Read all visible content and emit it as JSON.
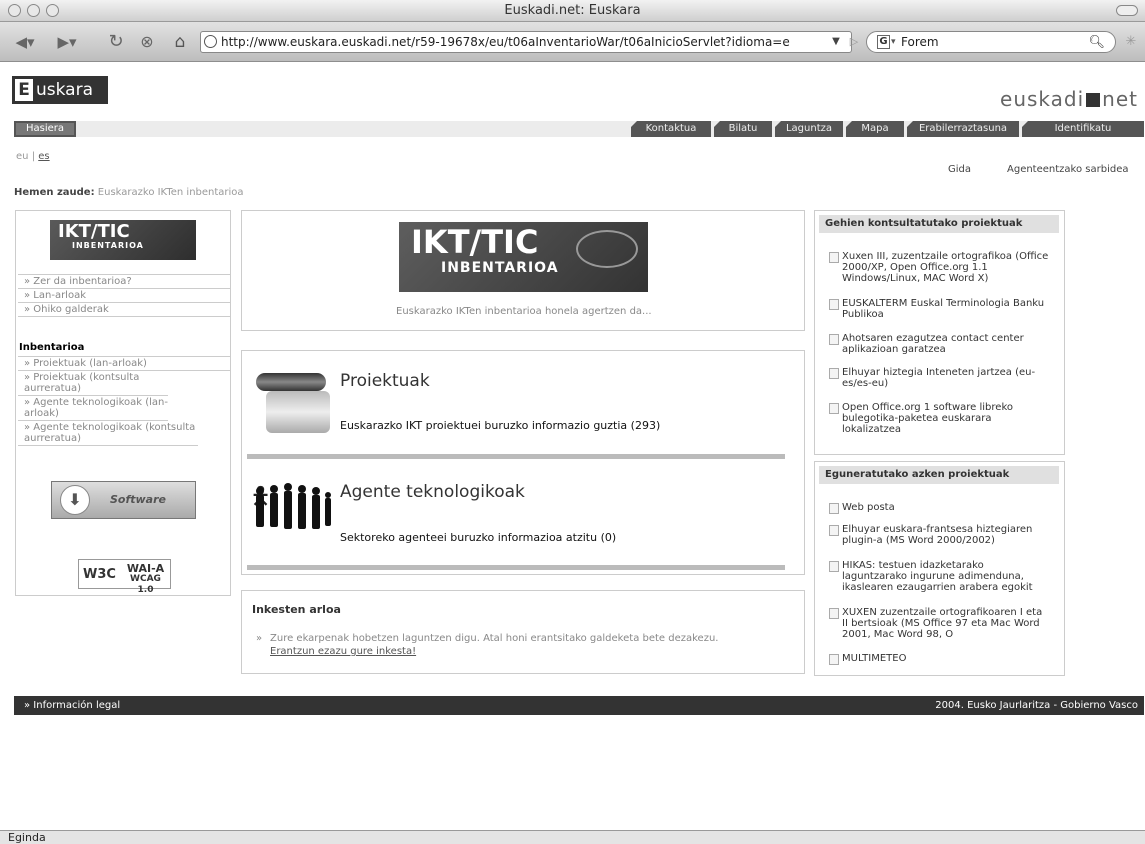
{
  "window": {
    "title": "Euskadi.net: Euskara"
  },
  "browser": {
    "url": "http://www.euskara.euskadi.net/r59-19678x/eu/t06aInventarioWar/t06aInicioServlet?idioma=e",
    "search_engine_letter": "G",
    "search_value": "Forem"
  },
  "header": {
    "logo_text": "uskara",
    "logo_letter": "E",
    "euskadi_logo_left": "euskadi",
    "euskadi_logo_right": "net"
  },
  "nav": {
    "home": "Hasiera",
    "tabs": [
      "Kontaktua",
      "Bilatu",
      "Laguntza",
      "Mapa",
      "Erabilerraztasuna",
      "Identifikatu"
    ]
  },
  "lang": {
    "current": "eu",
    "sep": "|",
    "other": "es"
  },
  "toplinks": {
    "gida": "Gida",
    "agents": "Agenteentzako sarbidea"
  },
  "breadcrumb": {
    "label": "Hemen zaude:",
    "path": "Euskarazko IKTen inbentarioa"
  },
  "left": {
    "ikt_title": "IKT/TIC",
    "ikt_sub": "INBENTARIOA",
    "links": [
      "» Zer da inbentarioa?",
      "» Lan-arloak",
      "» Ohiko galderak"
    ],
    "inv_heading": "Inbentarioa",
    "inv_links": [
      "» Proiektuak (lan-arloak)",
      "» Proiektuak (kontsulta aurreratua)",
      "» Agente teknologikoak (lan-arloak)",
      "» Agente teknologikoak (kontsulta aurreratua)"
    ],
    "software_label": "Software",
    "w3c_logo": "W3C",
    "wai": "WAI-A",
    "wcag": "WCAG 1.0"
  },
  "center": {
    "banner_title": "IKT/TIC",
    "banner_sub": "INBENTARIOA",
    "intro": "Euskarazko IKTen inbentarioa honela agertzen da...",
    "proiektuak_title": "Proiektuak",
    "proiektuak_desc": "Euskarazko IKT proiektuei buruzko informazio guztia (293)",
    "agente_title": "Agente teknologikoak",
    "agente_desc": "Sektoreko agenteei buruzko informazioa atzitu (0)",
    "inkesta_title": "Inkesten arloa",
    "inkesta_text": "Zure ekarpenak hobetzen laguntzen digu. Atal honi erantsitako galdeketa bete dezakezu.",
    "inkesta_link": "Erantzun ezazu gure inkesta!"
  },
  "right": {
    "top_heading": "Gehien kontsultatutako proiektuak",
    "top_items": [
      "Xuxen III, zuzentzaile ortografikoa (Office 2000/XP, Open Office.org 1.1 Windows/Linux, MAC Word X)",
      "EUSKALTERM Euskal Terminologia Banku Publikoa",
      "Ahotsaren ezagutzea contact center aplikazioan garatzea",
      "Elhuyar hiztegia Inteneten jartzea (eu-es/es-eu)",
      "Open Office.org 1 software libreko bulegotika-paketea euskarara lokalizatzea"
    ],
    "new_heading": "Eguneratutako azken proiektuak",
    "new_items": [
      "Web posta",
      "Elhuyar euskara-frantsesa hiztegiaren plugin-a (MS Word 2000/2002)",
      "HIKAS: testuen idazketarako laguntzarako ingurune adimenduna, ikaslearen ezaugarrien arabera egokit",
      "XUXEN zuzentzaile ortografikoaren I eta II bertsioak (MS Office 97 eta Mac Word 2001, Mac Word 98, O",
      "MULTIMETEO"
    ]
  },
  "footer": {
    "legal": "» Información legal",
    "copyright": "2004. Eusko Jaurlaritza - Gobierno Vasco"
  },
  "status": {
    "text": "Eginda"
  }
}
